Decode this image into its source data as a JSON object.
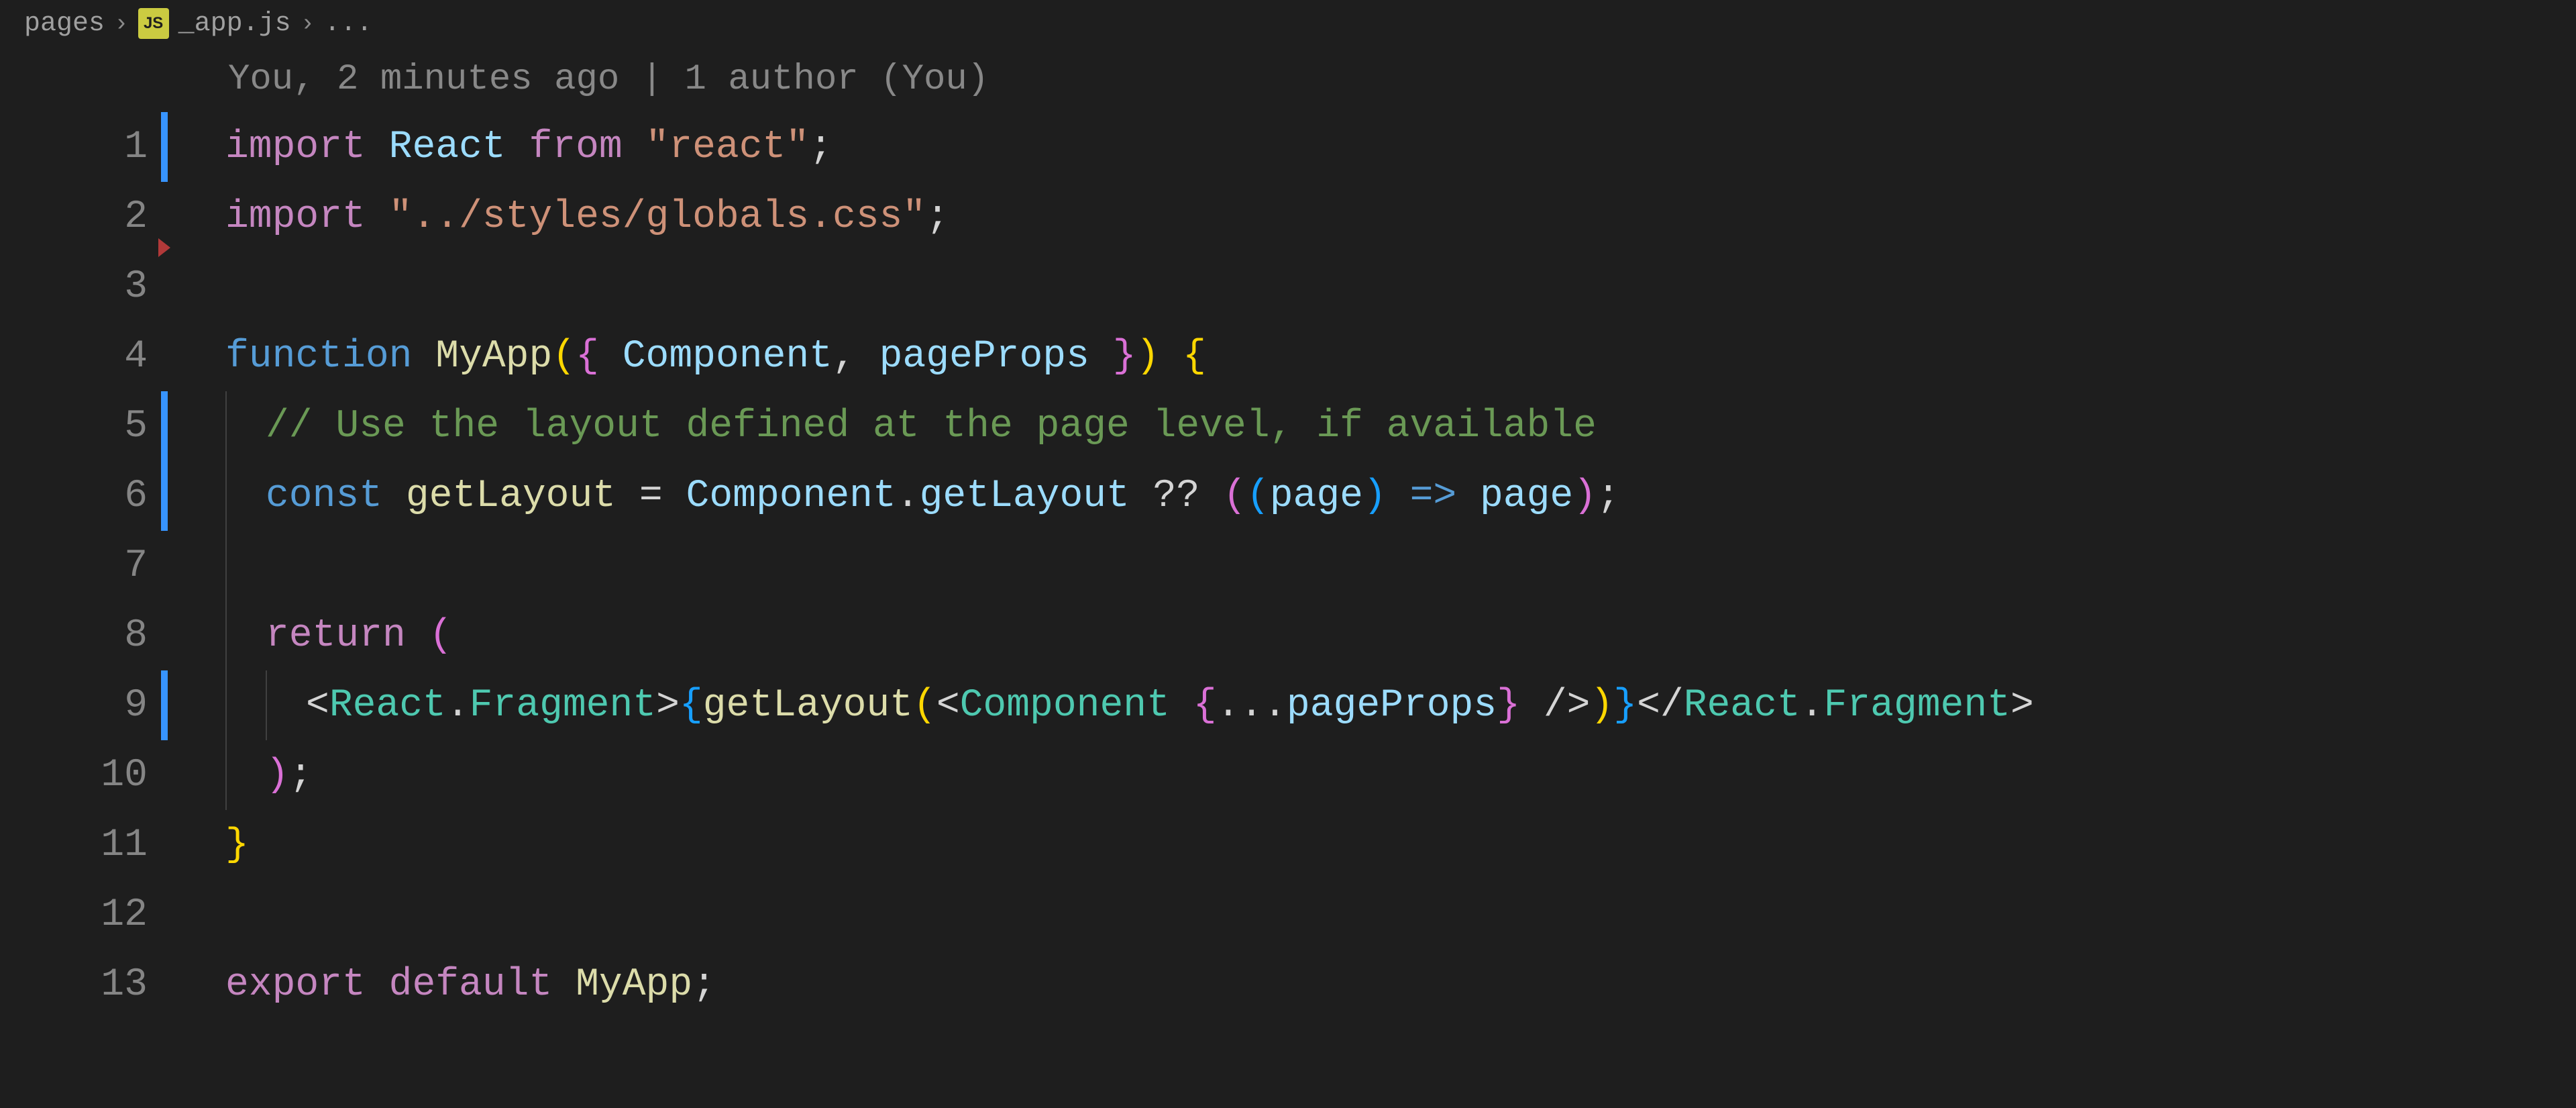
{
  "breadcrumb": {
    "folder": "pages",
    "icon_label": "JS",
    "file": "_app.js",
    "tail": "..."
  },
  "codelens": "You, 2 minutes ago | 1 author (You)",
  "lines": {
    "l1": {
      "n": "1",
      "mod": true,
      "t": {
        "a": "import ",
        "b": "React ",
        "c": "from ",
        "d": "\"react\"",
        "e": ";"
      }
    },
    "l2": {
      "n": "2",
      "mod": false,
      "tri": true,
      "t": {
        "a": "import ",
        "b": "\"../styles/globals.css\"",
        "c": ";"
      }
    },
    "l3": {
      "n": "3",
      "mod": false
    },
    "l4": {
      "n": "4",
      "mod": false,
      "t": {
        "a": "function ",
        "b": "MyApp",
        "c": "(",
        "d": "{ ",
        "e": "Component",
        "f": ", ",
        "g": "pageProps ",
        "h": "}",
        "i": ") ",
        "j": "{"
      }
    },
    "l5": {
      "n": "5",
      "mod": true,
      "t": {
        "a": "// Use the layout defined at the page level, if available"
      }
    },
    "l6": {
      "n": "6",
      "mod": true,
      "t": {
        "a": "const ",
        "b": "getLayout ",
        "c": "= ",
        "d": "Component",
        "e": ".",
        "f": "getLayout ",
        "g": "?? ",
        "h": "(",
        "i": "(",
        "j": "page",
        "k": ") ",
        "l": "=> ",
        "m": "page",
        "n": ")",
        "o": ";"
      }
    },
    "l7": {
      "n": "7",
      "mod": false
    },
    "l8": {
      "n": "8",
      "mod": false,
      "t": {
        "a": "return ",
        "b": "("
      }
    },
    "l9": {
      "n": "9",
      "mod": true,
      "t": {
        "a": "<",
        "b": "React",
        "c": ".",
        "d": "Fragment",
        "e": ">",
        "f": "{",
        "g": "getLayout",
        "h": "(",
        "i": "<",
        "j": "Component ",
        "k": "{",
        "l": "...",
        "m": "pageProps",
        "n": "} ",
        "o": "/>",
        "p": ")",
        "q": "}",
        "r": "</",
        "s": "React",
        "t2": ".",
        "u": "Fragment",
        "v": ">"
      }
    },
    "l10": {
      "n": "10",
      "mod": false,
      "t": {
        "a": ")",
        "b": ";"
      }
    },
    "l11": {
      "n": "11",
      "mod": false,
      "t": {
        "a": "}"
      }
    },
    "l12": {
      "n": "12",
      "mod": false
    },
    "l13": {
      "n": "13",
      "mod": false,
      "t": {
        "a": "export ",
        "b": "default ",
        "c": "MyApp",
        "d": ";"
      }
    }
  }
}
